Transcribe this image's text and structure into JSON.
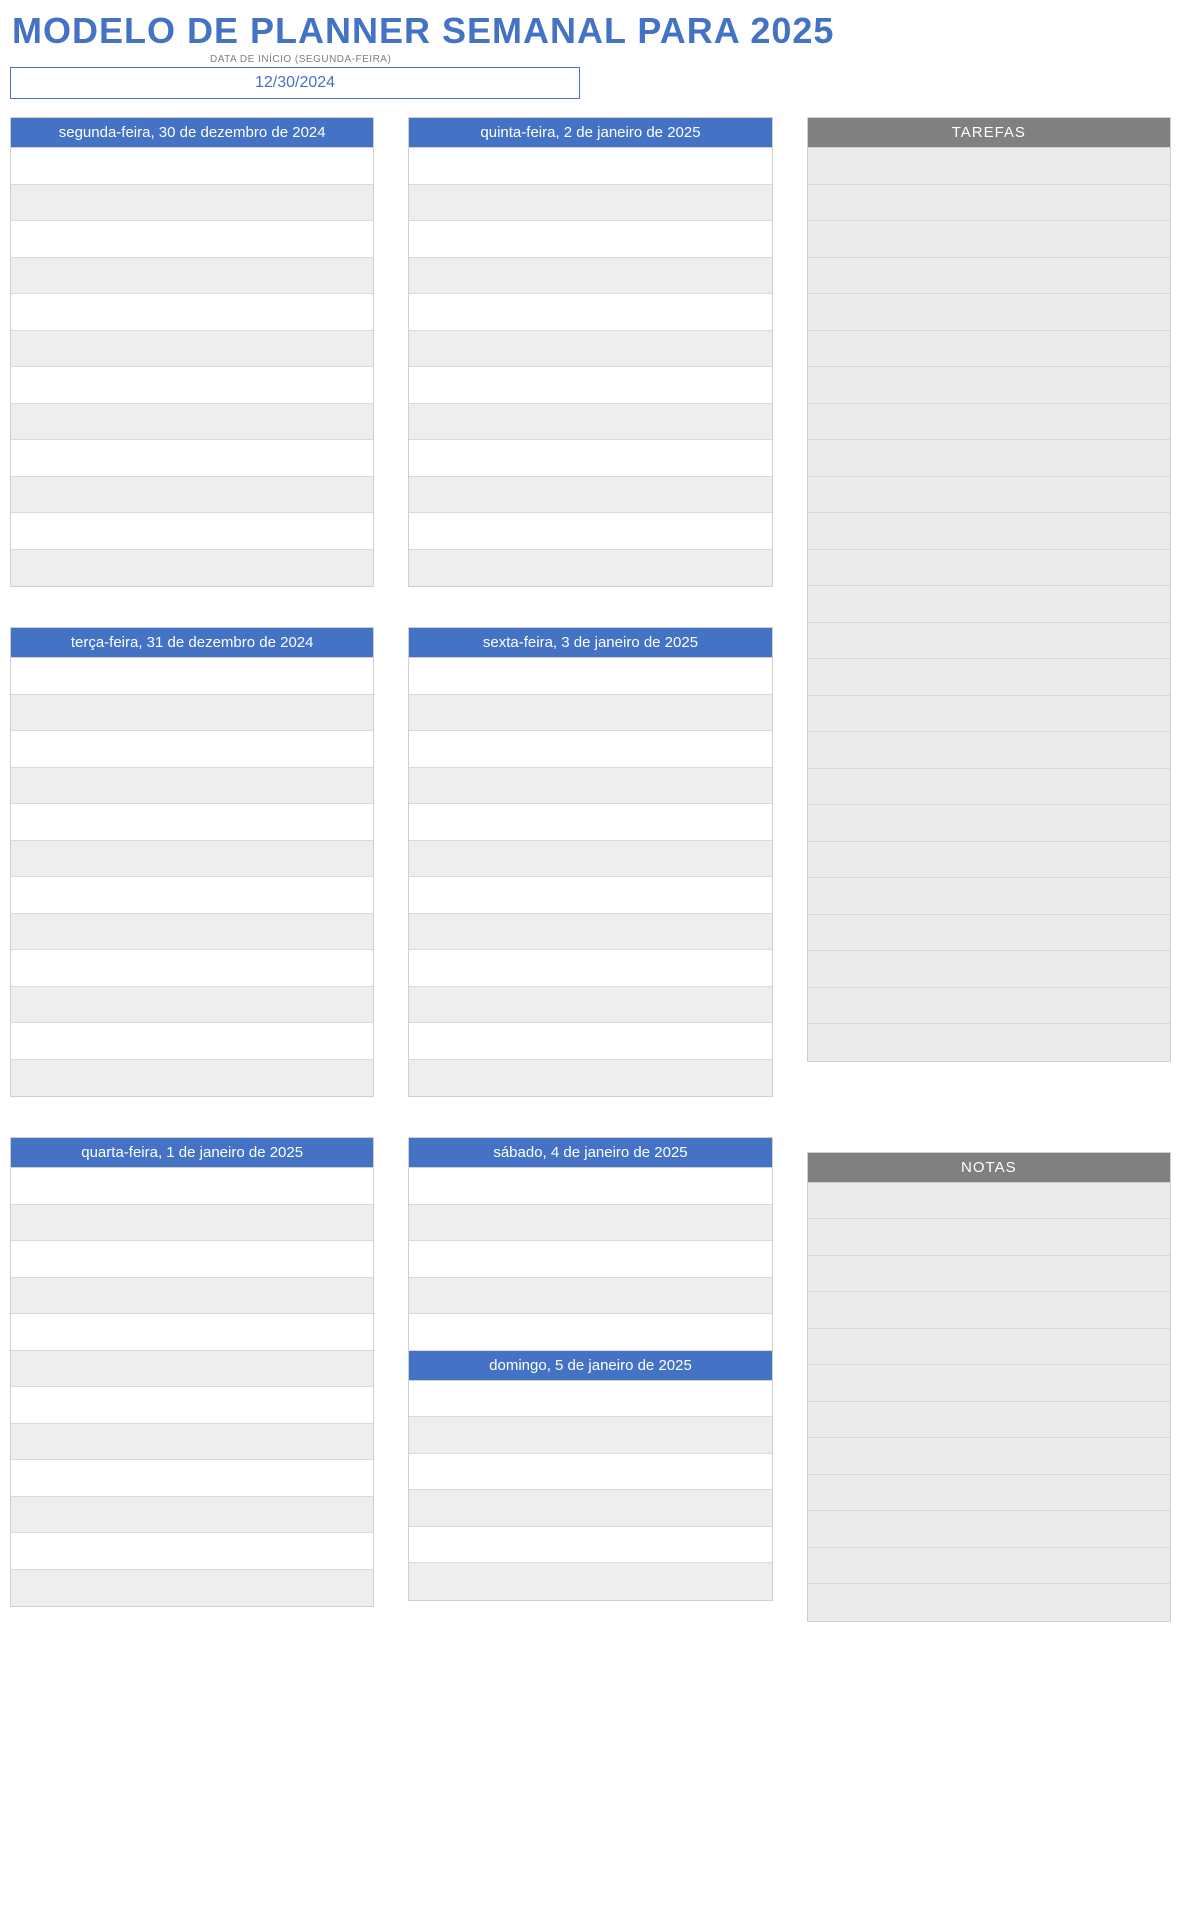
{
  "title": "MODELO DE PLANNER SEMANAL PARA 2025",
  "subtitle": "DATA DE INÍCIO (SEGUNDA-FEIRA)",
  "start_date": "12/30/2024",
  "days": {
    "monday": "segunda-feira, 30 de dezembro de 2024",
    "tuesday": "terça-feira, 31 de dezembro de 2024",
    "wednesday": "quarta-feira, 1 de janeiro de 2025",
    "thursday": "quinta-feira, 2 de janeiro de 2025",
    "friday": "sexta-feira, 3 de janeiro de 2025",
    "saturday": "sábado, 4 de janeiro de 2025",
    "sunday": "domingo, 5 de janeiro de 2025"
  },
  "sidebar": {
    "tasks_header": "TAREFAS",
    "notes_header": "NOTAS"
  }
}
